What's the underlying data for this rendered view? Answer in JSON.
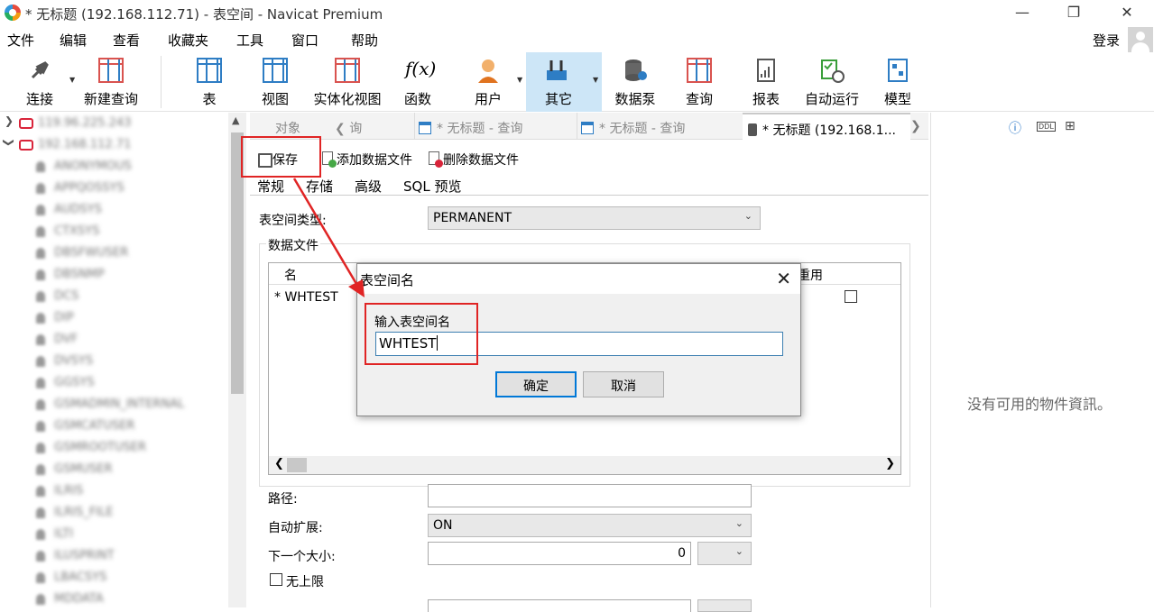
{
  "window": {
    "title": "* 无标题 (192.168.112.71) - 表空间 - Navicat Premium"
  },
  "menu": {
    "items": [
      "文件",
      "编辑",
      "查看",
      "收藏夹",
      "工具",
      "窗口",
      "帮助"
    ],
    "login": "登录"
  },
  "toolbar": {
    "items": [
      "连接",
      "新建查询",
      "表",
      "视图",
      "实体化视图",
      "函数",
      "用户",
      "其它",
      "数据泵",
      "查询",
      "报表",
      "自动运行",
      "模型"
    ]
  },
  "sidebar": {
    "connections": [
      "119.96.225.243",
      "192.168.112.71"
    ],
    "users": [
      "ANONYMOUS",
      "APPQOSSYS",
      "AUDSYS",
      "CTXSYS",
      "DBSFWUSER",
      "DBSNMP",
      "DCS",
      "DIP",
      "DVF",
      "DVSYS",
      "GGSYS",
      "GSMADMIN_INTERNAL",
      "GSMCATUSER",
      "GSMROOTUSER",
      "GSMUSER",
      "ILRIS",
      "ILRIS_FILE",
      "ILTI",
      "ILUSPRINT",
      "LBACSYS",
      "MDDATA"
    ]
  },
  "tabs": {
    "objects": "对象",
    "t1": "询",
    "t2": "* 无标题 - 查询",
    "t3": "* 无标题 - 查询",
    "t4": "* 无标题 (192.168.1..."
  },
  "editor": {
    "save": "保存",
    "add_file": "添加数据文件",
    "del_file": "删除数据文件",
    "subtabs": [
      "常规",
      "存储",
      "高级",
      "SQL 预览"
    ],
    "ts_type_label": "表空间类型:",
    "ts_type_value": "PERMANENT",
    "datafiles_label": "数据文件",
    "col_name": "名",
    "col_reuse": "重用",
    "row_marker": "*",
    "row_name": "WHTEST",
    "path_label": "路径:",
    "path_value": "",
    "autoextend_label": "自动扩展:",
    "autoextend_value": "ON",
    "next_label": "下一个大小:",
    "next_value": "0",
    "unlimited_label": "无上限"
  },
  "right_panel": {
    "no_info": "没有可用的物件資訊。"
  },
  "dialog": {
    "title": "表空间名",
    "prompt": "输入表空间名",
    "value": "WHTEST",
    "ok": "确定",
    "cancel": "取消"
  }
}
